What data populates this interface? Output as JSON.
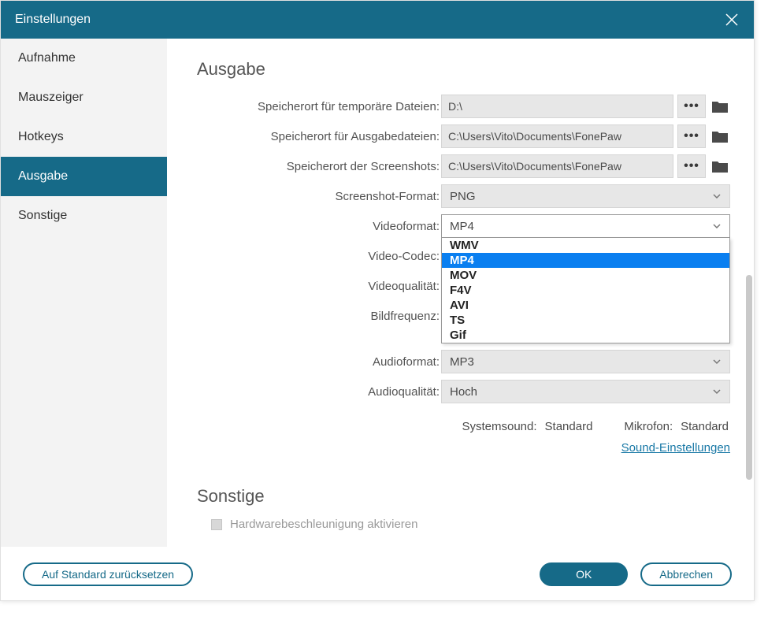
{
  "title": "Einstellungen",
  "sidebar": {
    "items": [
      {
        "label": "Aufnahme"
      },
      {
        "label": "Mauszeiger"
      },
      {
        "label": "Hotkeys"
      },
      {
        "label": "Ausgabe"
      },
      {
        "label": "Sonstige"
      }
    ],
    "active_index": 3
  },
  "main": {
    "section_title": "Ausgabe",
    "temp_path": {
      "label": "Speicherort für temporäre Dateien:",
      "value": "D:\\"
    },
    "output_path": {
      "label": "Speicherort für Ausgabedateien:",
      "value": "C:\\Users\\Vito\\Documents\\FonePaw"
    },
    "screenshot_path": {
      "label": "Speicherort der Screenshots:",
      "value": "C:\\Users\\Vito\\Documents\\FonePaw"
    },
    "screenshot_format": {
      "label": "Screenshot-Format:",
      "value": "PNG"
    },
    "video_format": {
      "label": "Videoformat:",
      "value": "MP4",
      "options": [
        "WMV",
        "MP4",
        "MOV",
        "F4V",
        "AVI",
        "TS",
        "Gif"
      ]
    },
    "video_codec": {
      "label": "Video-Codec:"
    },
    "video_quality": {
      "label": "Videoqualität:"
    },
    "framerate": {
      "label": "Bildfrequenz:"
    },
    "audio_format": {
      "label": "Audioformat:",
      "value": "MP3"
    },
    "audio_quality": {
      "label": "Audioqualität:",
      "value": "Hoch"
    },
    "systemsound": {
      "label": "Systemsound:",
      "value": "Standard"
    },
    "microphone": {
      "label": "Mikrofon:",
      "value": "Standard"
    },
    "sound_link": "Sound-Einstellungen",
    "section2_title": "Sonstige",
    "hw_accel": "Hardwarebeschleunigung aktivieren"
  },
  "footer": {
    "reset": "Auf Standard zurücksetzen",
    "ok": "OK",
    "cancel": "Abbrechen"
  }
}
